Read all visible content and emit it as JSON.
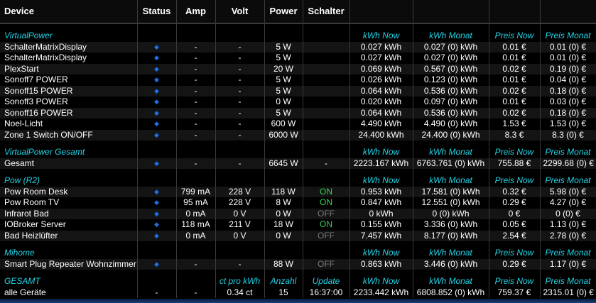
{
  "header": {
    "device": "Device",
    "status": "Status",
    "amp": "Amp",
    "volt": "Volt",
    "power": "Power",
    "schalter": "Schalter"
  },
  "colors": {
    "section": "#22d3e6",
    "on": "#2fd34a",
    "off": "#7a7a7a",
    "status_dot": "#1e6fe0"
  },
  "sections": [
    {
      "title": "VirtualPower",
      "labels": [
        "kWh Now",
        "kWh Monat",
        "Preis Now",
        "Preis Monat"
      ],
      "rows": [
        {
          "name": "SchalterMatrixDisplay",
          "status": "◆",
          "amp": "-",
          "volt": "-",
          "power": "5 W",
          "schalter": "",
          "kwh_now": "0.027 kWh",
          "kwh_monat": "0.027 (0) kWh",
          "preis_now": "0.01 €",
          "preis_monat": "0.01 (0) €"
        },
        {
          "name": "SchalterMatrixDisplay",
          "status": "◆",
          "amp": "-",
          "volt": "-",
          "power": "5 W",
          "schalter": "",
          "kwh_now": "0.027 kWh",
          "kwh_monat": "0.027 (0) kWh",
          "preis_now": "0.01 €",
          "preis_monat": "0.01 (0) €"
        },
        {
          "name": "PlexStart",
          "status": "◆",
          "amp": "-",
          "volt": "-",
          "power": "20 W",
          "schalter": "",
          "kwh_now": "0.069 kWh",
          "kwh_monat": "0.567 (0) kWh",
          "preis_now": "0.02 €",
          "preis_monat": "0.19 (0) €"
        },
        {
          "name": "Sonoff7 POWER",
          "status": "◆",
          "amp": "-",
          "volt": "-",
          "power": "5 W",
          "schalter": "",
          "kwh_now": "0.026 kWh",
          "kwh_monat": "0.123 (0) kWh",
          "preis_now": "0.01 €",
          "preis_monat": "0.04 (0) €"
        },
        {
          "name": "Sonoff15 POWER",
          "status": "◆",
          "amp": "-",
          "volt": "-",
          "power": "5 W",
          "schalter": "",
          "kwh_now": "0.064 kWh",
          "kwh_monat": "0.536 (0) kWh",
          "preis_now": "0.02 €",
          "preis_monat": "0.18 (0) €"
        },
        {
          "name": "Sonoff3 POWER",
          "status": "◆",
          "amp": "-",
          "volt": "-",
          "power": "0 W",
          "schalter": "",
          "kwh_now": "0.020 kWh",
          "kwh_monat": "0.097 (0) kWh",
          "preis_now": "0.01 €",
          "preis_monat": "0.03 (0) €"
        },
        {
          "name": "Sonoff16 POWER",
          "status": "◆",
          "amp": "-",
          "volt": "-",
          "power": "5 W",
          "schalter": "",
          "kwh_now": "0.064 kWh",
          "kwh_monat": "0.536 (0) kWh",
          "preis_now": "0.02 €",
          "preis_monat": "0.18 (0) €"
        },
        {
          "name": "Noel-Licht",
          "status": "◆",
          "amp": "-",
          "volt": "-",
          "power": "600 W",
          "schalter": "",
          "kwh_now": "4.490 kWh",
          "kwh_monat": "4.490 (0) kWh",
          "preis_now": "1.53 €",
          "preis_monat": "1.53 (0) €"
        },
        {
          "name": "Zone 1 Switch ON/OFF",
          "status": "◆",
          "amp": "-",
          "volt": "-",
          "power": "6000 W",
          "schalter": "",
          "kwh_now": "24.400 kWh",
          "kwh_monat": "24.400 (0) kWh",
          "preis_now": "8.3 €",
          "preis_monat": "8.3 (0) €"
        }
      ]
    },
    {
      "title": "VirtualPower Gesamt",
      "labels": [
        "kWh Now",
        "kWh Monat",
        "Preis Now",
        "Preis Monat"
      ],
      "rows": [
        {
          "name": "Gesamt",
          "status": "◆",
          "amp": "-",
          "volt": "-",
          "power": "6645 W",
          "schalter": "-",
          "kwh_now": "2223.167 kWh",
          "kwh_monat": "6763.761 (0) kWh",
          "preis_now": "755.88 €",
          "preis_monat": "2299.68 (0) €"
        }
      ]
    },
    {
      "title": "Pow (R2)",
      "labels": [
        "kWh Now",
        "kWh Monat",
        "Preis Now",
        "Preis Monat"
      ],
      "rows": [
        {
          "name": "Pow Room Desk",
          "status": "◆",
          "amp": "799 mA",
          "volt": "228 V",
          "power": "118 W",
          "schalter": "ON",
          "kwh_now": "0.953 kWh",
          "kwh_monat": "17.581 (0) kWh",
          "preis_now": "0.32 €",
          "preis_monat": "5.98 (0) €"
        },
        {
          "name": "Pow Room TV",
          "status": "◆",
          "amp": "95 mA",
          "volt": "228 V",
          "power": "8 W",
          "schalter": "ON",
          "kwh_now": "0.847 kWh",
          "kwh_monat": "12.551 (0) kWh",
          "preis_now": "0.29 €",
          "preis_monat": "4.27 (0) €"
        },
        {
          "name": "Infrarot Bad",
          "status": "◆",
          "amp": "0 mA",
          "volt": "0 V",
          "power": "0 W",
          "schalter": "OFF",
          "kwh_now": "0 kWh",
          "kwh_monat": "0 (0) kWh",
          "preis_now": "0 €",
          "preis_monat": "0 (0) €"
        },
        {
          "name": "IOBroker Server",
          "status": "◆",
          "amp": "118 mA",
          "volt": "211 V",
          "power": "18 W",
          "schalter": "ON",
          "kwh_now": "0.155 kWh",
          "kwh_monat": "3.336 (0) kWh",
          "preis_now": "0.05 €",
          "preis_monat": "1.13 (0) €"
        },
        {
          "name": "Bad Heizlüfter",
          "status": "◆",
          "amp": "0 mA",
          "volt": "0 V",
          "power": "0 W",
          "schalter": "OFF",
          "kwh_now": "7.457 kWh",
          "kwh_monat": "8.177 (0) kWh",
          "preis_now": "2.54 €",
          "preis_monat": "2.78 (0) €"
        }
      ]
    },
    {
      "title": "Mihome",
      "labels": [
        "kWh Now",
        "kWh Monat",
        "Preis Now",
        "Preis Monat"
      ],
      "rows": [
        {
          "name": "Smart Plug Repeater Wohnzimmer",
          "status": "◆",
          "amp": "-",
          "volt": "-",
          "power": "88 W",
          "schalter": "OFF",
          "kwh_now": "0.863 kWh",
          "kwh_monat": "3.446 (0) kWh",
          "preis_now": "0.29 €",
          "preis_monat": "1.17 (0) €"
        }
      ]
    }
  ],
  "gesamt": {
    "title": "GESAMT",
    "labels": {
      "volt": "ct pro kWh",
      "power": "Anzahl",
      "schalter": "Update",
      "kwh_now": "kWh Now",
      "kwh_monat": "kWh Monat",
      "preis_now": "Preis Now",
      "preis_monat": "Preis Monat"
    },
    "row": {
      "name": "alle Geräte",
      "status": "-",
      "amp": "-",
      "volt": "0.34 ct",
      "power": "15",
      "schalter": "16:37:00",
      "kwh_now": "2233.442 kWh",
      "kwh_monat": "6808.852 (0) kWh",
      "preis_now": "759.37 €",
      "preis_monat": "2315.01 (0) €"
    }
  }
}
